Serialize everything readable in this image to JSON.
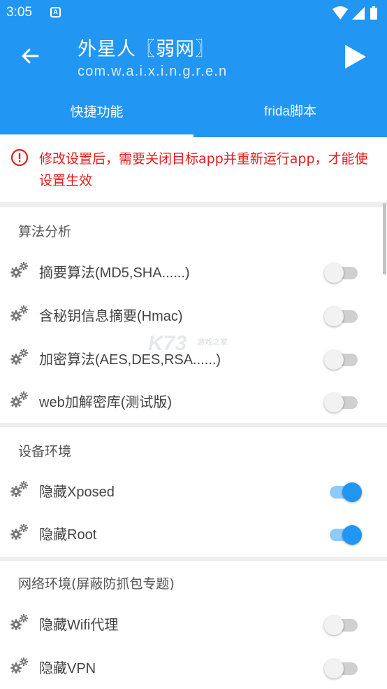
{
  "status_bar": {
    "time": "3:05",
    "notification_icon": "A",
    "icons": [
      "wifi-icon",
      "signal-icon",
      "battery-icon"
    ]
  },
  "app_bar": {
    "title": "外星人〖弱网〗",
    "subtitle": "com.w.a.i.x.i.n.g.r.e.n",
    "back_icon": "arrow-left-icon",
    "run_icon": "play-icon"
  },
  "tabs": [
    {
      "label": "快捷功能",
      "selected": true
    },
    {
      "label": "frida脚本",
      "selected": false
    }
  ],
  "notice": {
    "icon": "warning-circle-icon",
    "text": "修改设置后，需要关闭目标app并重新运行app，才能使设置生效",
    "color": "#e31d1d"
  },
  "sections": [
    {
      "title": "算法分析",
      "items": [
        {
          "label": "摘要算法(MD5,SHA......)",
          "enabled": false
        },
        {
          "label": "含秘钥信息摘要(Hmac)",
          "enabled": false
        },
        {
          "label": "加密算法(AES,DES,RSA......)",
          "enabled": false
        },
        {
          "label": "web加解密库(测试版)",
          "enabled": false
        }
      ]
    },
    {
      "title": "设备环境",
      "items": [
        {
          "label": "隐藏Xposed",
          "enabled": true
        },
        {
          "label": "隐藏Root",
          "enabled": true
        }
      ]
    },
    {
      "title": "网络环境(屏蔽防抓包专题)",
      "items": [
        {
          "label": "隐藏Wifi代理",
          "enabled": false
        },
        {
          "label": "隐藏VPN",
          "enabled": false
        }
      ]
    }
  ],
  "watermark": {
    "big": "K73",
    "small": "游戏之家"
  },
  "colors": {
    "primary": "#2196f3",
    "warning": "#e31d1d",
    "switch_on_track": "#90caf9"
  }
}
